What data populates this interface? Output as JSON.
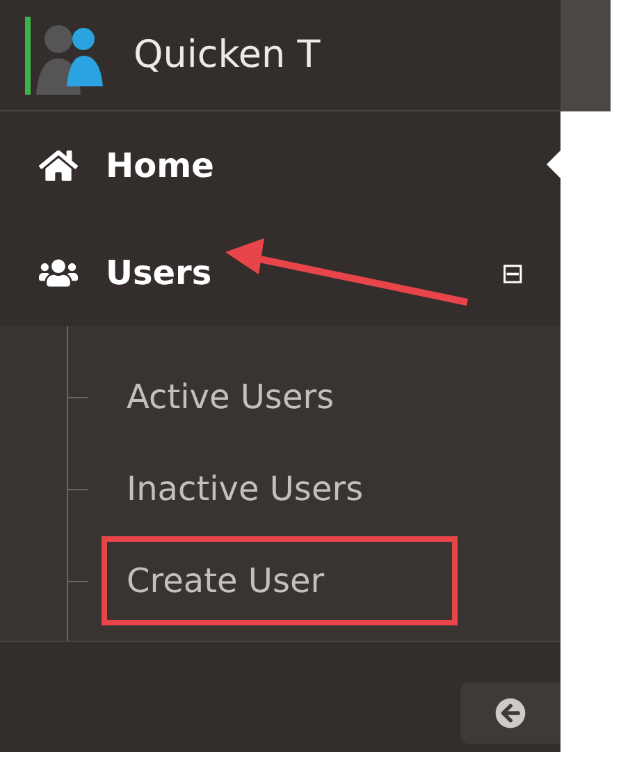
{
  "header": {
    "title": "Quicken T"
  },
  "nav": [
    {
      "kind": "link",
      "label": "Home",
      "selected": true,
      "annotated": false
    },
    {
      "kind": "group",
      "label": "Users",
      "selected": false,
      "annotated": true,
      "expanded": true,
      "toggle": "⊟",
      "children": [
        {
          "label": "Active Users",
          "highlighted": false
        },
        {
          "label": "Inactive Users",
          "highlighted": false
        },
        {
          "label": "Create User",
          "highlighted": true
        }
      ]
    }
  ]
}
